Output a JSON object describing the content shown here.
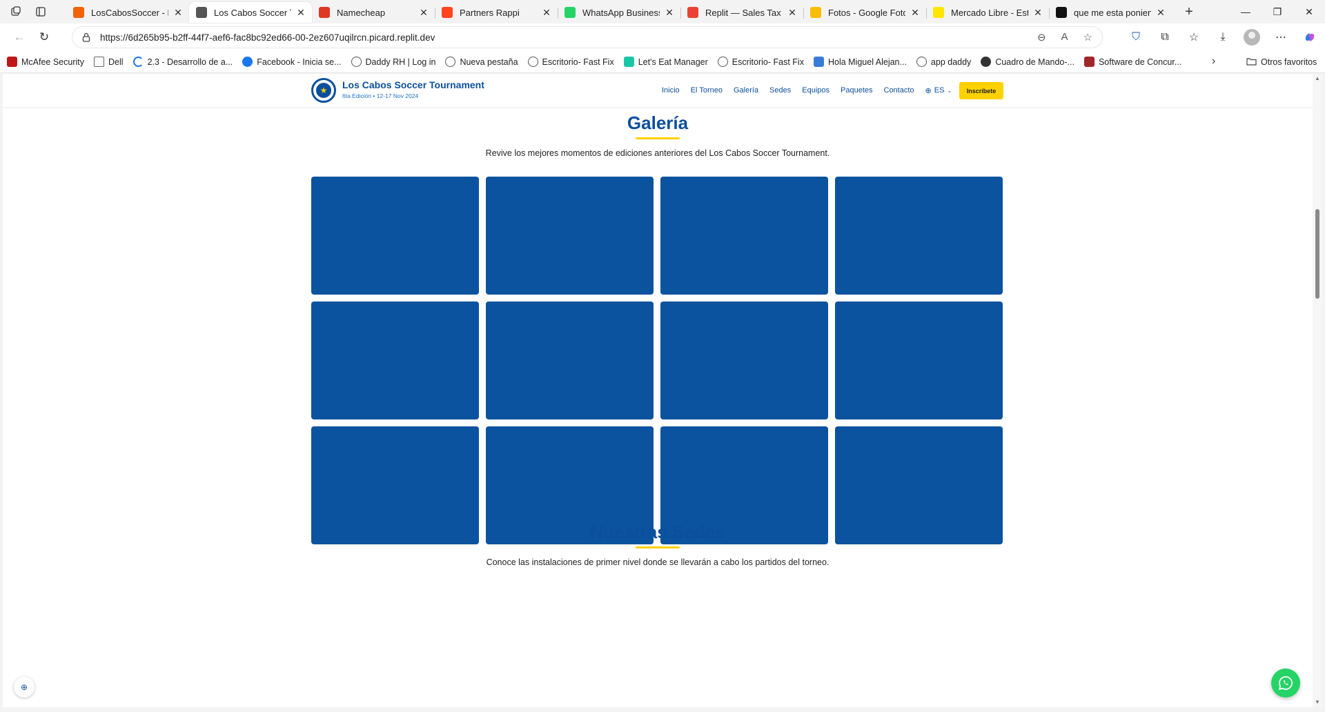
{
  "browser": {
    "tabs": [
      {
        "title": "LosCabosSoccer - Rep",
        "favicon_color": "#f26207",
        "active": false
      },
      {
        "title": "Los Cabos Soccer Tour",
        "favicon_color": "#555555",
        "active": true
      },
      {
        "title": "Namecheap",
        "favicon_color": "#de3723",
        "active": false
      },
      {
        "title": "Partners Rappi",
        "favicon_color": "#ff441f",
        "active": false
      },
      {
        "title": "WhatsApp Business",
        "favicon_color": "#25d366",
        "active": false
      },
      {
        "title": "Replit — Sales Tax Col",
        "favicon_color": "#ea4335",
        "active": false
      },
      {
        "title": "Fotos - Google Fotos",
        "favicon_color": "#fbbc04",
        "active": false
      },
      {
        "title": "Mercado Libre - Estad",
        "favicon_color": "#ffe600",
        "active": false
      },
      {
        "title": "que me esta poniendo",
        "favicon_color": "#111111",
        "active": false
      }
    ],
    "url": "https://6d265b95-b2ff-44f7-aef6-fac8bc92ed66-00-2ez607uqilrcn.picard.replit.dev",
    "bookmarks": [
      {
        "label": "McAfee Security",
        "icon": "mcafee-icon",
        "color": "#c01818"
      },
      {
        "label": "Dell",
        "icon": "folder-icon",
        "color": "#666666"
      },
      {
        "label": "2.3 - Desarrollo de a...",
        "icon": "loading-icon",
        "color": "#1a73e8"
      },
      {
        "label": "Facebook - Inicia se...",
        "icon": "facebook-icon",
        "color": "#1877f2"
      },
      {
        "label": "Daddy RH | Log in",
        "icon": "globe-icon",
        "color": "#555555"
      },
      {
        "label": "Nueva pestaña",
        "icon": "globe-icon",
        "color": "#555555"
      },
      {
        "label": "Escritorio- Fast Fix",
        "icon": "globe-icon",
        "color": "#555555"
      },
      {
        "label": "Let's Eat Manager",
        "icon": "lets-eat-icon",
        "color": "#1bc5a8"
      },
      {
        "label": "Escritorio- Fast Fix",
        "icon": "globe-icon",
        "color": "#555555"
      },
      {
        "label": "Hola Miguel Alejan...",
        "icon": "chart-icon",
        "color": "#3b7bd8"
      },
      {
        "label": "app daddy",
        "icon": "globe-icon",
        "color": "#555555"
      },
      {
        "label": "Cuadro de Mando-...",
        "icon": "dashboard-icon",
        "color": "#333333"
      },
      {
        "label": "Software de Concur...",
        "icon": "software-icon",
        "color": "#a0282b"
      }
    ],
    "other_favorites": "Otros favoritos"
  },
  "site": {
    "brand_title": "Los Cabos Soccer Tournament",
    "brand_subtitle": "6ta Edición • 12-17 Nov 2024",
    "nav": [
      "Inicio",
      "El Torneo",
      "Galería",
      "Sedes",
      "Equipos",
      "Paquetes",
      "Contacto"
    ],
    "language": "ES",
    "cta": "Inscríbete",
    "gallery": {
      "title": "Galería",
      "description": "Revive los mejores momentos de ediciones anteriores del Los Cabos Soccer Tournament.",
      "items": 12,
      "tile_color": "#0b539f"
    },
    "venues": {
      "title": "Nuestras Sedes",
      "description": "Conoce las instalaciones de primer nivel donde se llevarán a cabo los partidos del torneo."
    },
    "colors": {
      "primary": "#0b4f9c",
      "accent": "#ffd100",
      "whatsapp": "#25d366"
    }
  }
}
